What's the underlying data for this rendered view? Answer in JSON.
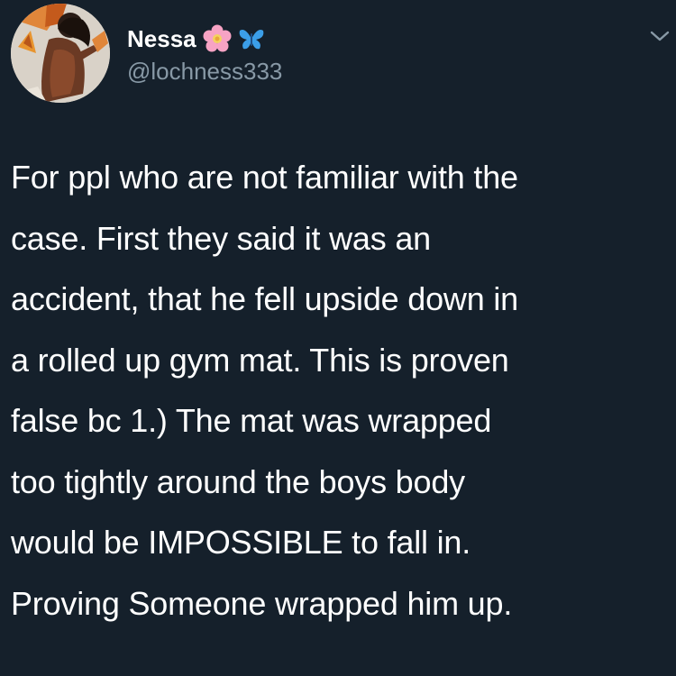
{
  "user": {
    "display_name": "Nessa",
    "handle": "@lochness333",
    "badges": [
      "flower-emoji",
      "butterfly-emoji"
    ]
  },
  "tweet": {
    "lines": [
      "For ppl who are not familiar with the",
      "case. First they said it was an",
      "accident, that he fell upside down in",
      "a rolled up gym mat. This is proven",
      "false bc 1.) The mat was wrapped",
      "too tightly around the boys body",
      "would be IMPOSSIBLE to fall in.",
      "Proving Someone wrapped him up."
    ]
  },
  "icons": {
    "menu": "chevron-down-icon",
    "avatar": "avatar"
  },
  "colors": {
    "background": "#15202b",
    "text": "#ffffff",
    "secondary_text": "#8899a6",
    "flower": "#f7a3c4",
    "butterfly": "#3b9ee8"
  }
}
